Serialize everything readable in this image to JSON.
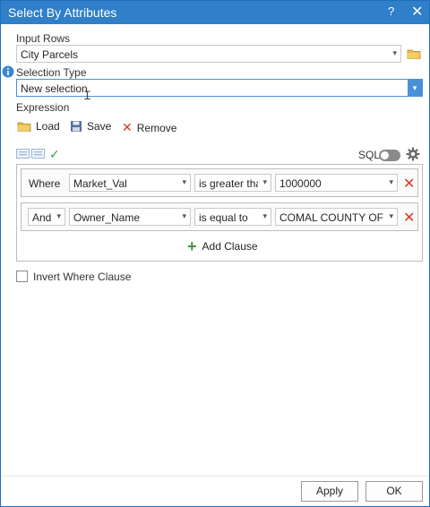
{
  "window": {
    "title": "Select By Attributes",
    "help": "?",
    "close": "✕"
  },
  "input_rows": {
    "label": "Input Rows",
    "value": "City Parcels"
  },
  "selection_type": {
    "label": "Selection Type",
    "value": "New selection"
  },
  "expression": {
    "label": "Expression",
    "load_label": "Load",
    "save_label": "Save",
    "remove_label": "Remove"
  },
  "sql_label": "SQL",
  "clauses": [
    {
      "connector": "Where",
      "field": "Market_Val",
      "operator": "is greater thar",
      "value": "1000000"
    },
    {
      "connector": "And",
      "field": "Owner_Name",
      "operator": "is equal to",
      "value": "COMAL COUNTY OF"
    }
  ],
  "add_clause_label": "Add Clause",
  "invert_label": "Invert Where Clause",
  "buttons": {
    "apply": "Apply",
    "ok": "OK"
  },
  "colors": {
    "titlebar": "#2f7fc9",
    "accent": "#4a90d9",
    "remove": "#d43a26",
    "add": "#3c9a3c"
  }
}
